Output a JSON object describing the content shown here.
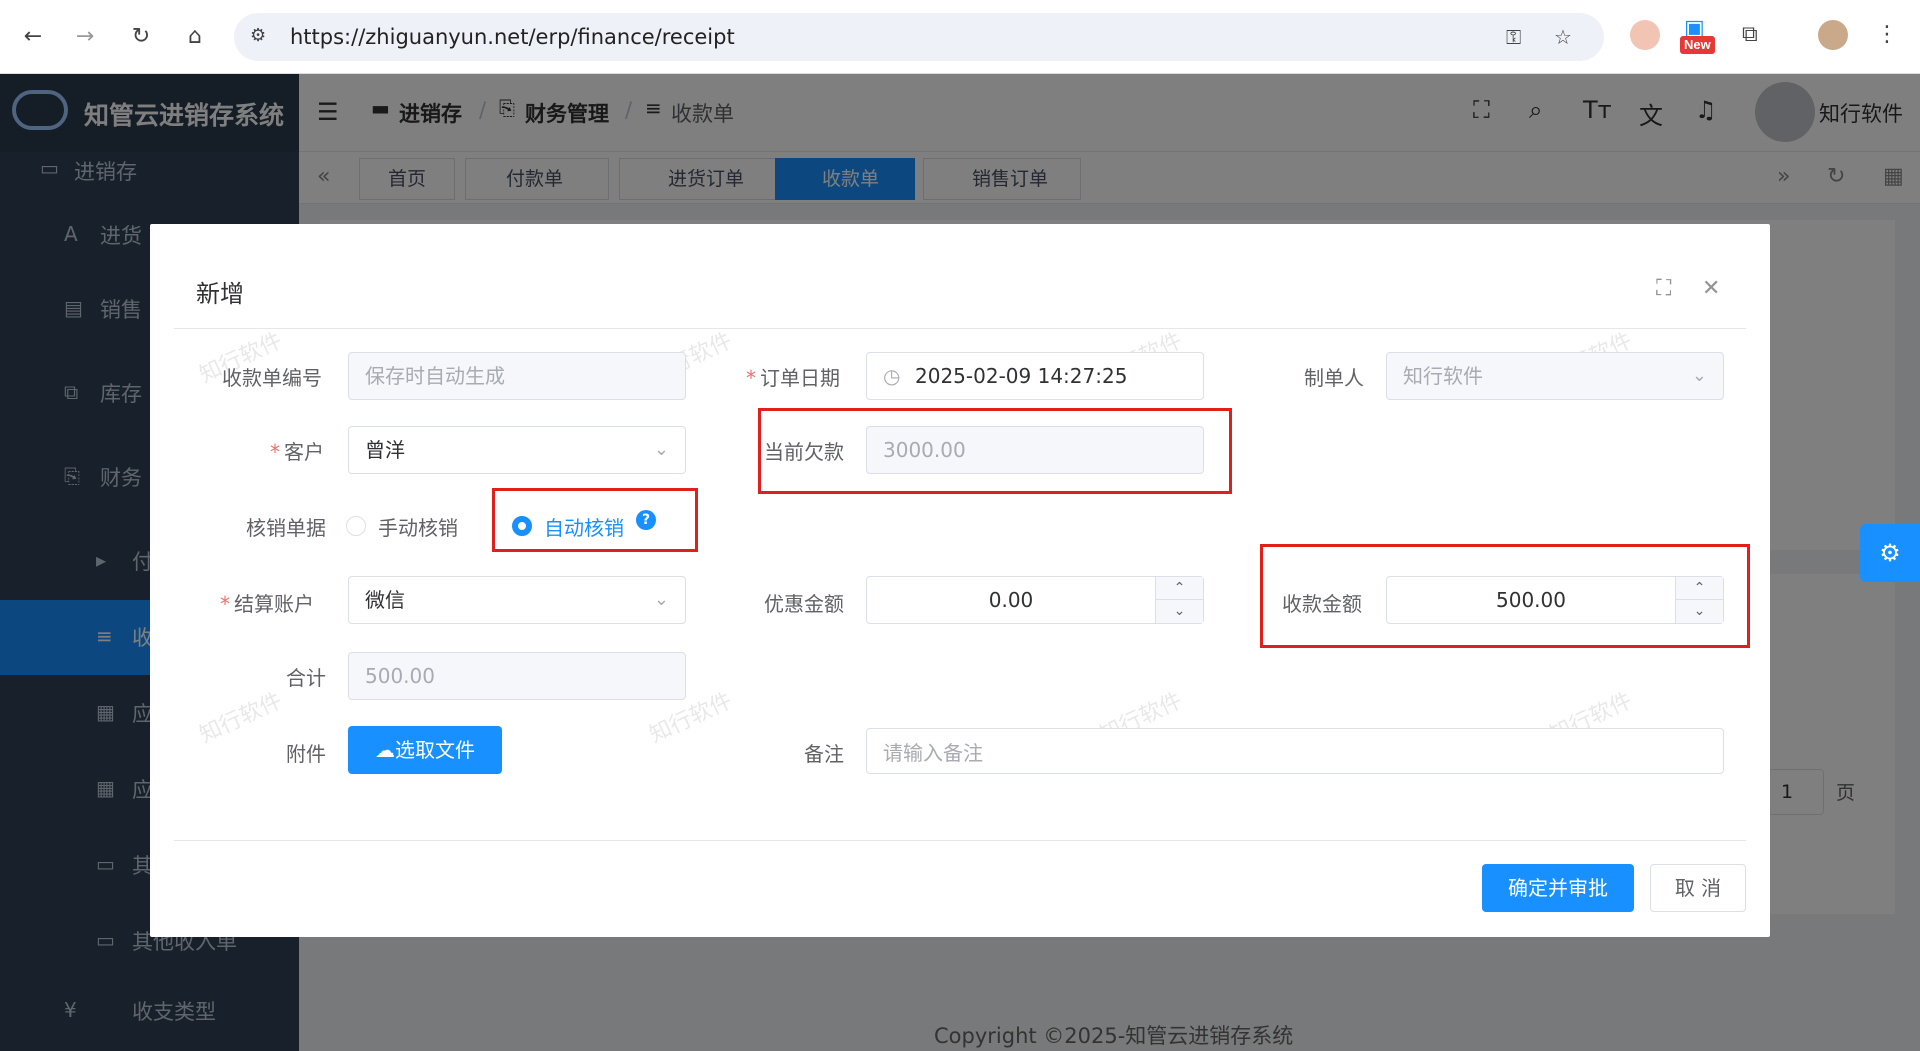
{
  "browser": {
    "url": "https://zhiguanyun.net/erp/finance/receipt",
    "new_badge": "New"
  },
  "sidebar": {
    "logo_text": "知管云进销存系统",
    "collapsed_header": "进销存",
    "items": [
      {
        "label": "进货",
        "icon": "A"
      },
      {
        "label": "销售",
        "icon": "▤"
      },
      {
        "label": "库存",
        "icon": "⧉"
      },
      {
        "label": "财务",
        "icon": "⎘"
      },
      {
        "label": "付",
        "icon": "▸"
      },
      {
        "label": "收",
        "icon": "≡"
      },
      {
        "label": "应",
        "icon": "▦"
      },
      {
        "label": "应",
        "icon": "▦"
      },
      {
        "label": "其",
        "icon": "▭"
      },
      {
        "label": "其他收入单",
        "icon": "▭"
      },
      {
        "label": "收支类型",
        "icon": "¥"
      }
    ]
  },
  "topbar": {
    "crumbs": [
      "进销存",
      "财务管理",
      "收款单"
    ],
    "user_name": "知行软件"
  },
  "tags": [
    "首页",
    "付款单",
    "进货订单",
    "收款单",
    "销售订单"
  ],
  "pager": {
    "page": "1",
    "unit": "页"
  },
  "copyright": "Copyright ©2025-知管云进销存系统",
  "dialog": {
    "title": "新增",
    "fields": {
      "receipt_no_label": "收款单编号",
      "receipt_no_placeholder": "保存时自动生成",
      "order_date_label": "订单日期",
      "order_date_value": "2025-02-09 14:27:25",
      "maker_label": "制单人",
      "maker_value": "知行软件",
      "customer_label": "客户",
      "customer_value": "曾洋",
      "debt_label": "当前欠款",
      "debt_value": "3000.00",
      "writeoff_label": "核销单据",
      "writeoff_manual": "手动核销",
      "writeoff_auto": "自动核销",
      "account_label": "结算账户",
      "account_value": "微信",
      "discount_label": "优惠金额",
      "discount_value": "0.00",
      "amount_label": "收款金额",
      "amount_value": "500.00",
      "total_label": "合计",
      "total_value": "500.00",
      "attach_label": "附件",
      "upload_btn": "选取文件",
      "remark_label": "备注",
      "remark_placeholder": "请输入备注"
    },
    "buttons": {
      "confirm": "确定并审批",
      "cancel": "取 消"
    },
    "watermark": "知行软件",
    "highlight_color": "#e0201c"
  }
}
